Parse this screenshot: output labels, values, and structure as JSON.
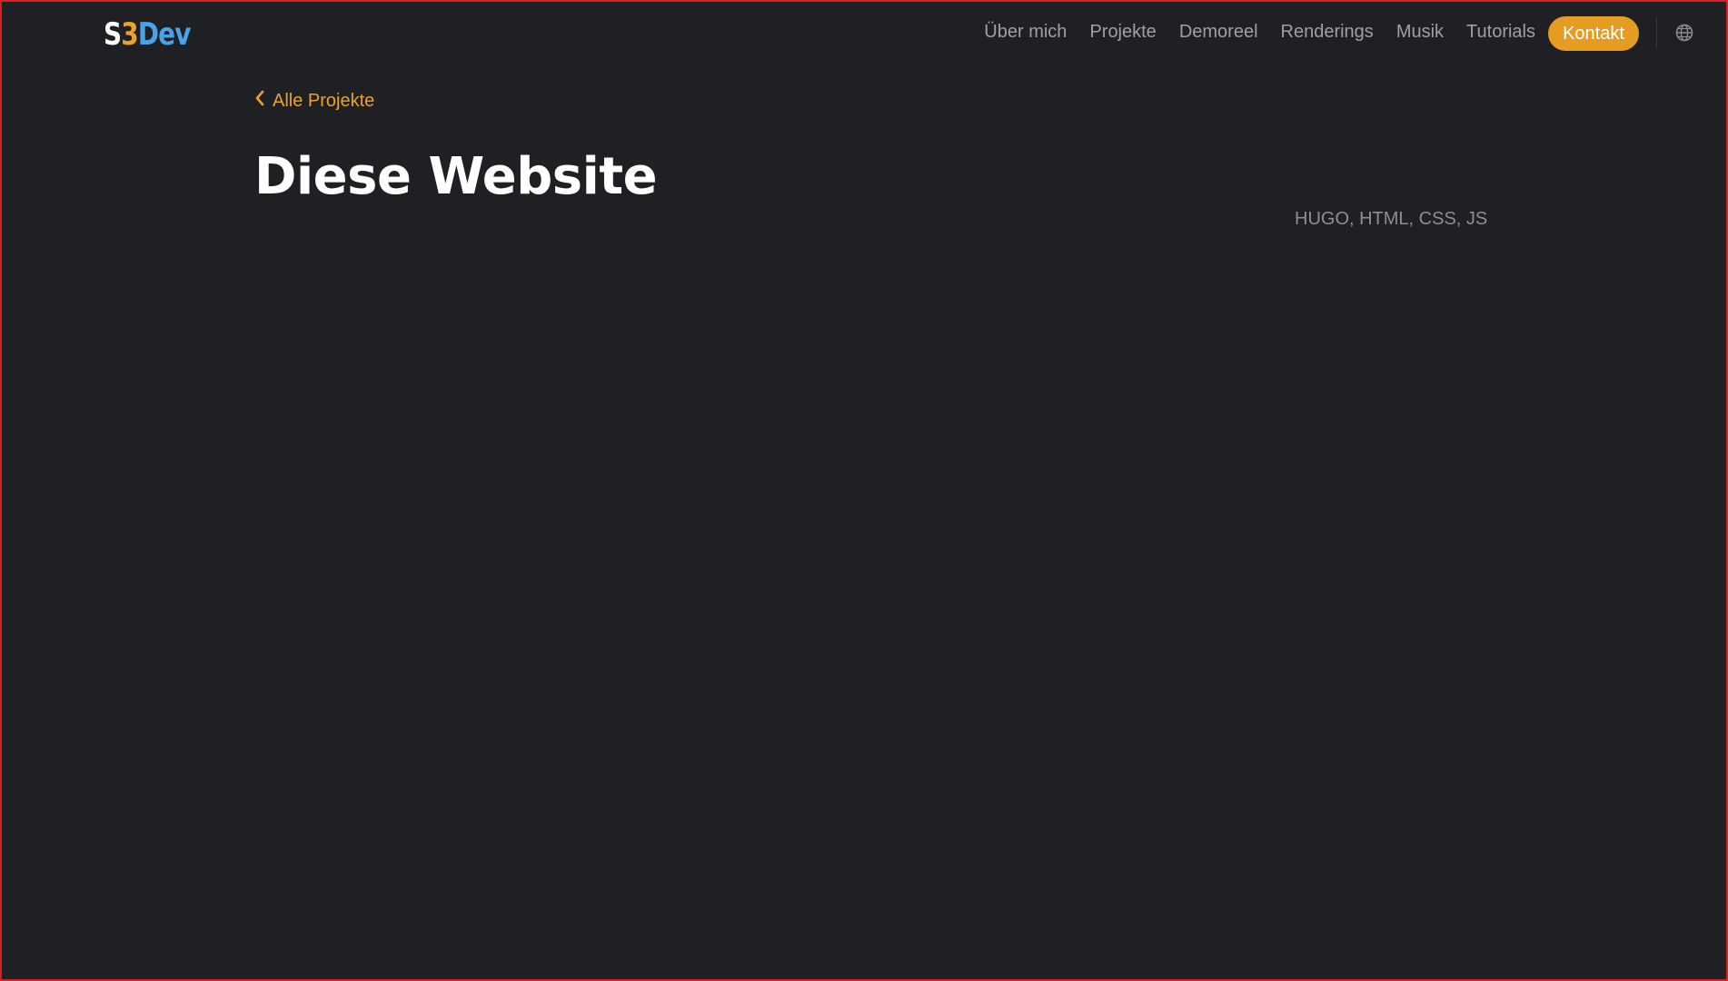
{
  "logo": {
    "part_s": "S",
    "part_3": "3",
    "part_dev": "Dev"
  },
  "nav": {
    "items": [
      {
        "label": "Über mich"
      },
      {
        "label": "Projekte"
      },
      {
        "label": "Demoreel"
      },
      {
        "label": "Renderings"
      },
      {
        "label": "Musik"
      },
      {
        "label": "Tutorials"
      }
    ],
    "contact_label": "Kontakt",
    "language_icon": "globe-icon"
  },
  "back": {
    "label": "Alle Projekte",
    "icon": "chevron-left-icon"
  },
  "project": {
    "title": "Diese Website",
    "tags": "HUGO, HTML, CSS, JS"
  },
  "colors": {
    "background": "#1f2023",
    "accent": "#e49c22",
    "logo_blue": "#4aa3e6",
    "nav_text": "#9fa0a5",
    "title": "#ffffff",
    "frame": "#d71f26"
  }
}
